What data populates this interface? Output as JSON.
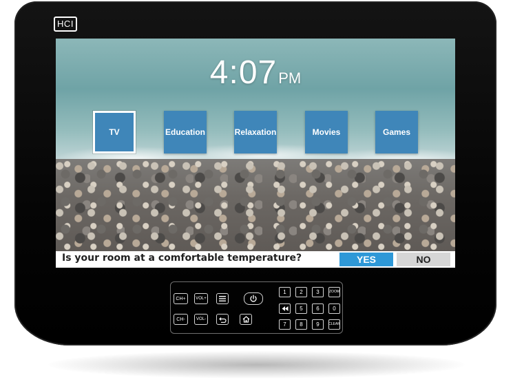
{
  "brand": {
    "logo": "HCI"
  },
  "clock": {
    "time": "4:07",
    "period": "PM"
  },
  "menu": {
    "items": [
      {
        "label": "TV",
        "selected": true
      },
      {
        "label": "Education",
        "selected": false
      },
      {
        "label": "Relaxation",
        "selected": false
      },
      {
        "label": "Movies",
        "selected": false
      },
      {
        "label": "Games",
        "selected": false
      }
    ]
  },
  "survey": {
    "question": "Is your room at a comfortable temperature?",
    "yes_label": "YES",
    "no_label": "NO"
  },
  "remote": {
    "ch_up": "CH+",
    "vol_up": "VOL+",
    "ch_down": "CH-",
    "vol_down": "VOL-",
    "keypad": [
      "1",
      "2",
      "3",
      "ZOOM",
      "4",
      "5",
      "6",
      "0",
      "7",
      "8",
      "9",
      "CLEAR"
    ],
    "menu_icon": "menu-icon",
    "power_icon": "power-icon",
    "back_icon": "back-icon",
    "home_icon": "home-icon",
    "rewind_icon": "rewind-icon"
  },
  "colors": {
    "tile": "#3f86b9",
    "yes": "#2e98d7",
    "no": "#d6d6d6",
    "bezel": "#0a0a0a"
  }
}
